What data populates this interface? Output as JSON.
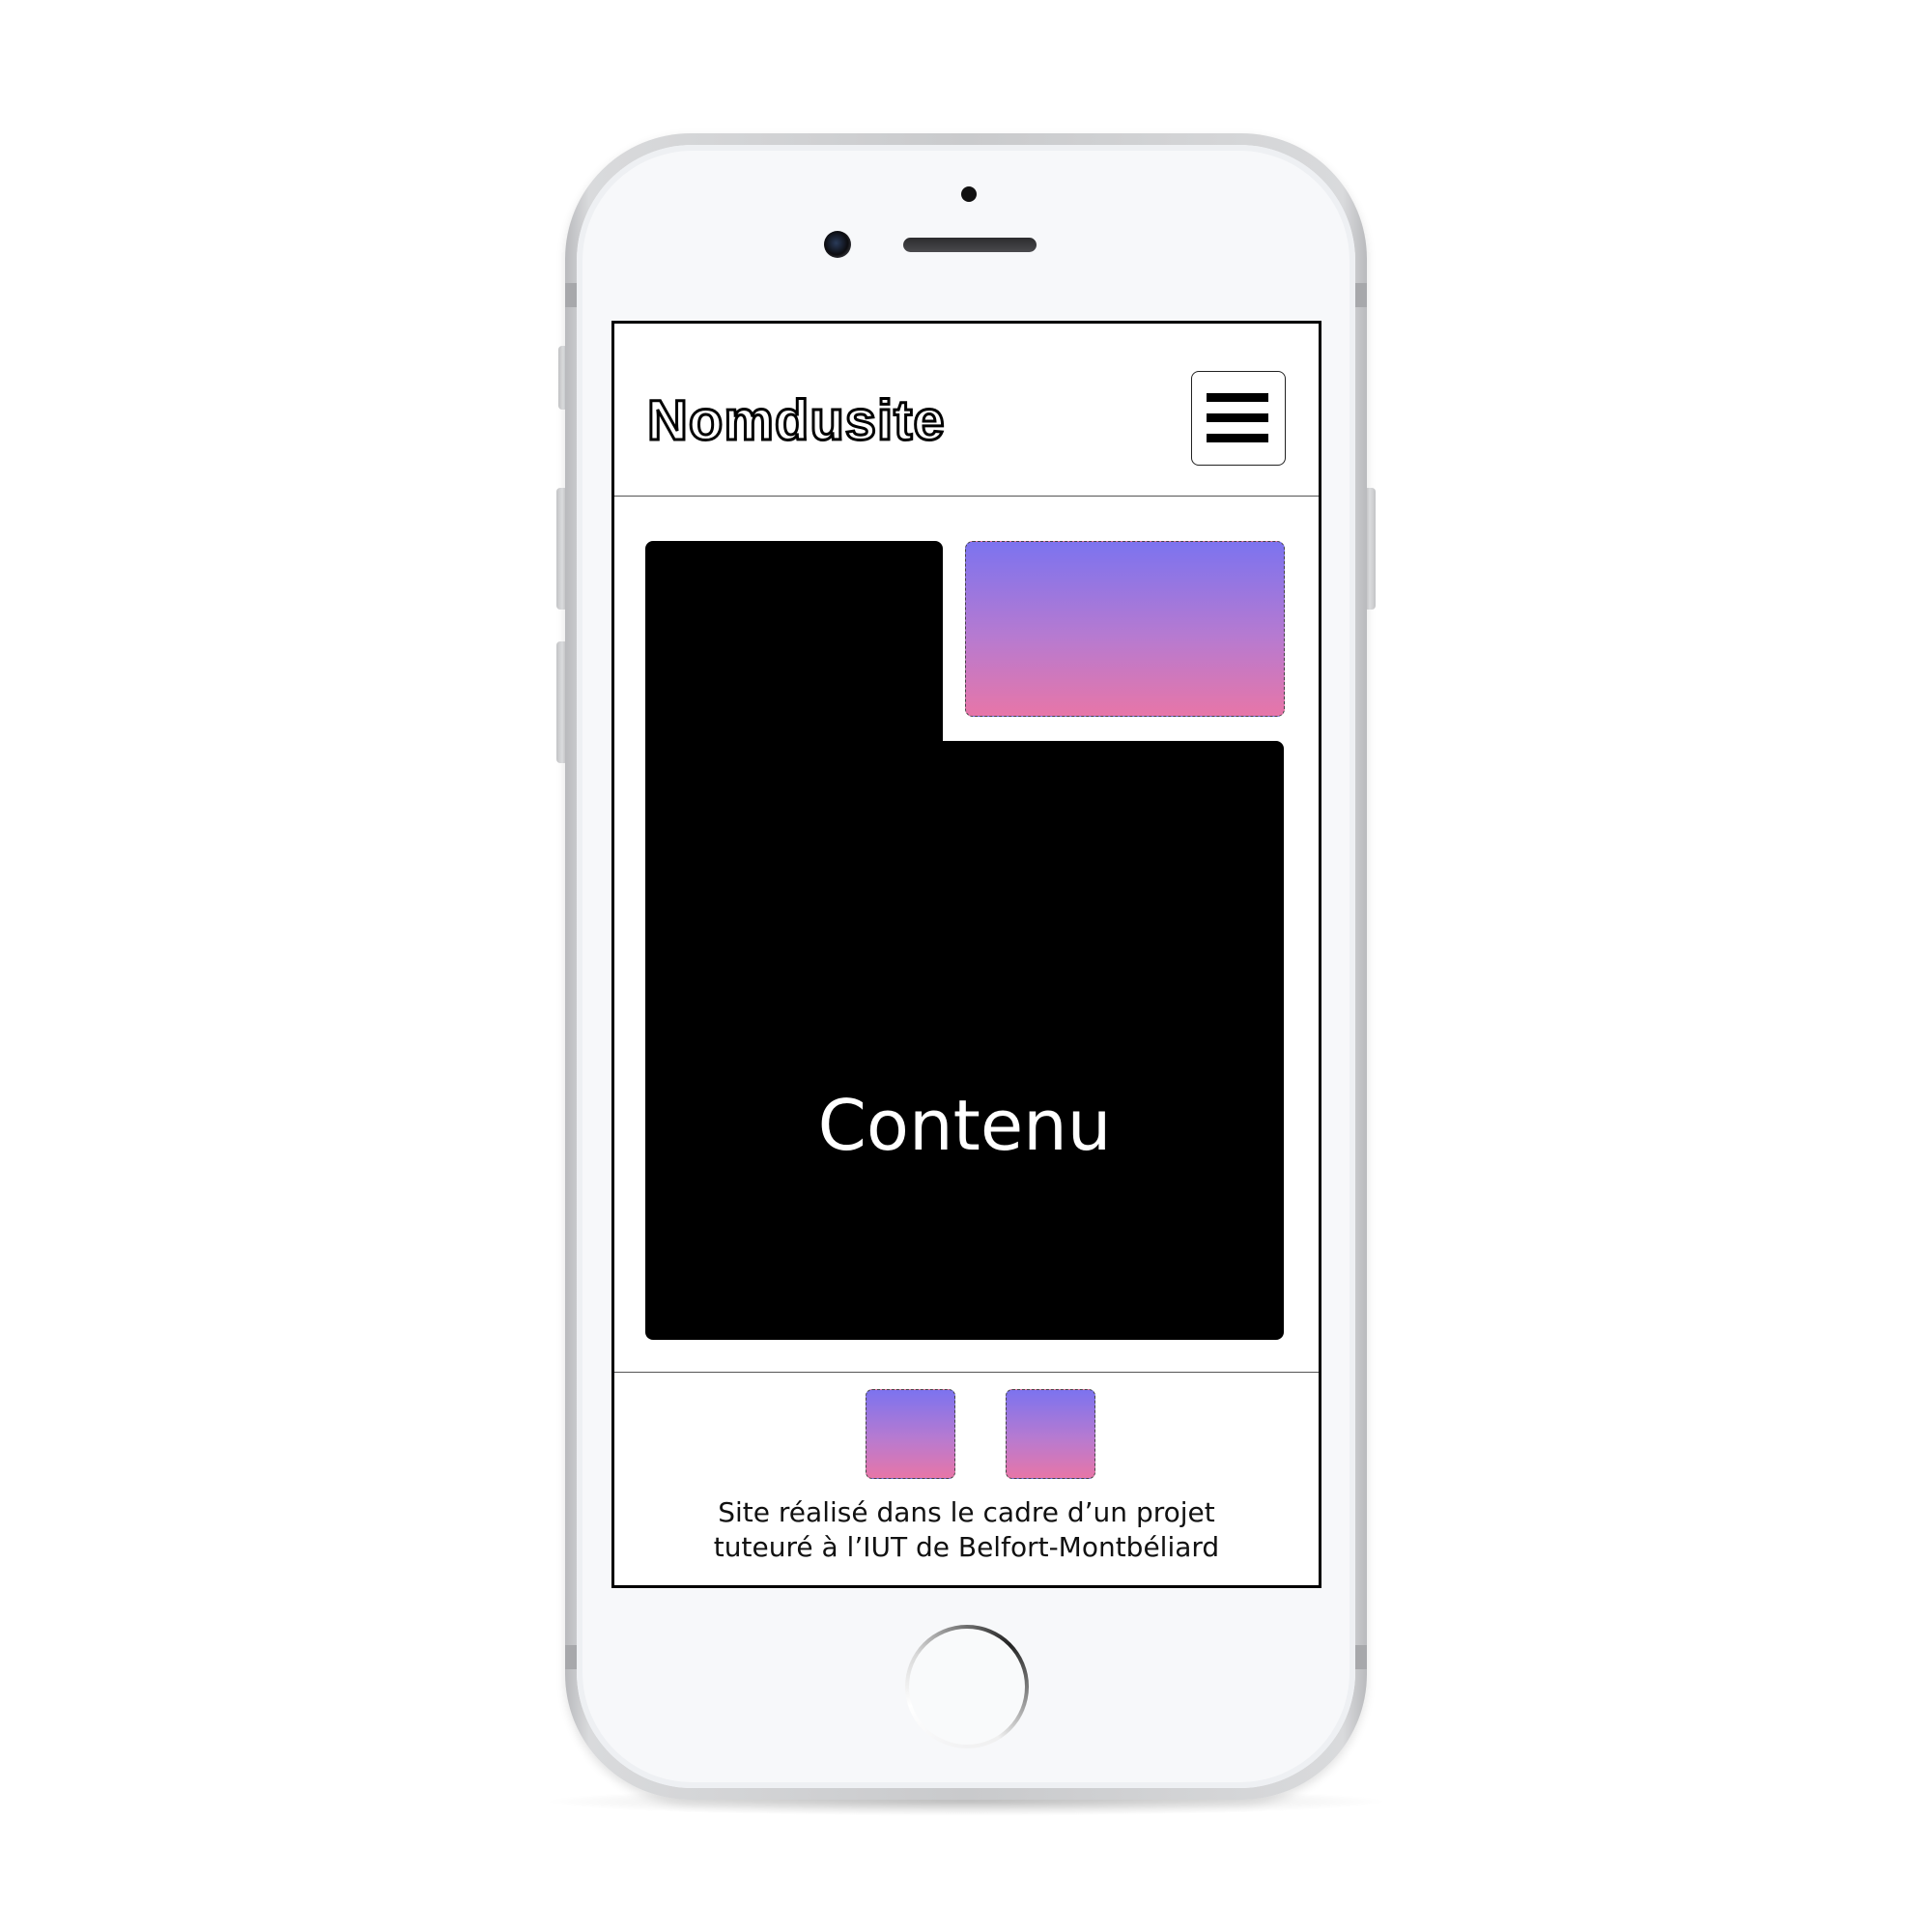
{
  "site": {
    "logo_text": "Nomdusite",
    "menu_icon": "hamburger-menu-icon"
  },
  "main": {
    "content_label": "Contenu"
  },
  "footer": {
    "social_icons": [
      "social-placeholder-icon",
      "social-placeholder-icon"
    ],
    "text_line1": "Site réalisé dans le cadre d’un projet",
    "text_line2": "tuteuré à l’IUT de Belfort-Montbéliard"
  },
  "colors": {
    "gradient_top": "#7c73ef",
    "gradient_bottom": "#e776a8",
    "content_bg": "#000000",
    "screen_bg": "#ffffff"
  }
}
